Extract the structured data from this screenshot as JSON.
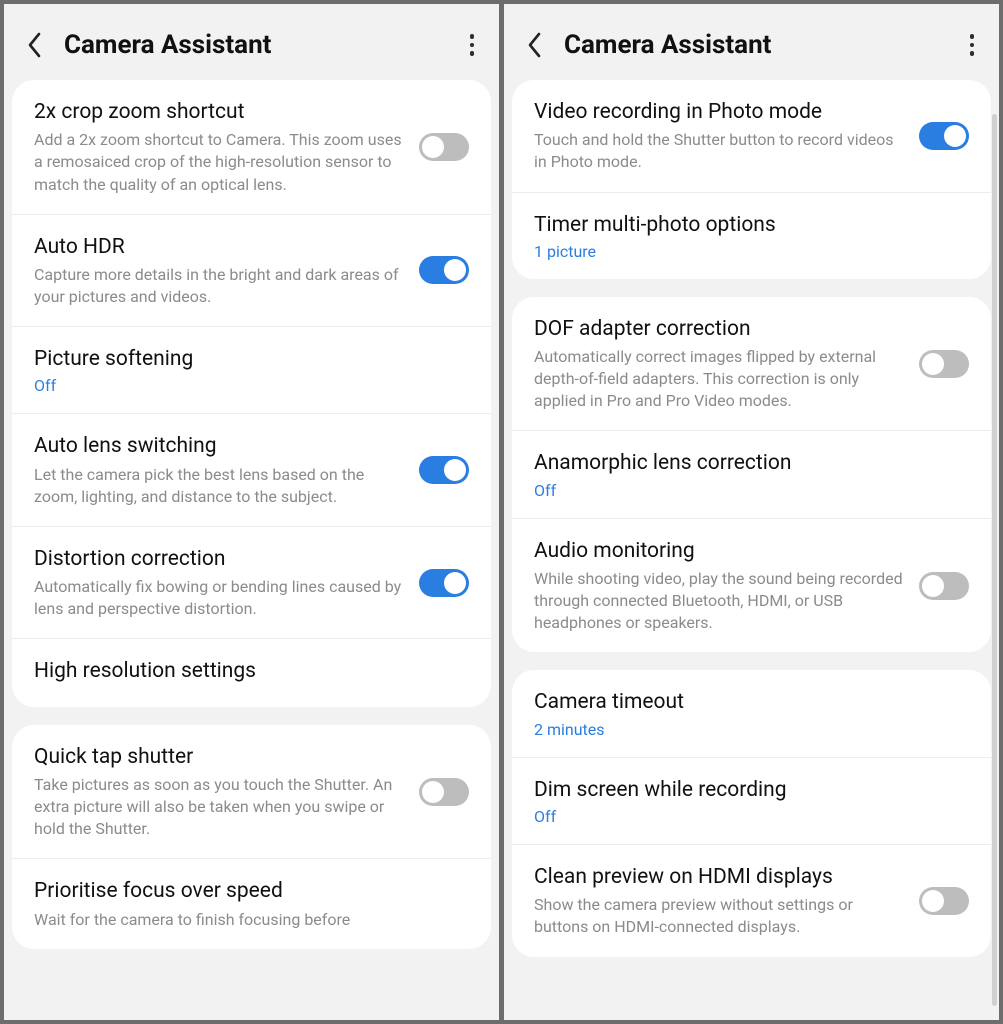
{
  "accent": "#2a7de1",
  "left": {
    "title": "Camera Assistant",
    "groups": [
      {
        "rows": [
          {
            "title": "2x crop zoom shortcut",
            "sub": "Add a 2x zoom shortcut to Camera. This zoom uses a remosaiced crop of the high-resolution sensor to match the quality of an optical lens.",
            "toggle": "off"
          },
          {
            "title": "Auto HDR",
            "sub": "Capture more details in the bright and dark areas of your pictures and videos.",
            "toggle": "on"
          },
          {
            "title": "Picture softening",
            "value": "Off"
          },
          {
            "title": "Auto lens switching",
            "sub": "Let the camera pick the best lens based on the zoom, lighting, and distance to the subject.",
            "toggle": "on"
          },
          {
            "title": "Distortion correction",
            "sub": "Automatically fix bowing or bending lines caused by lens and perspective distortion.",
            "toggle": "on"
          },
          {
            "title": "High resolution settings"
          }
        ]
      },
      {
        "rows": [
          {
            "title": "Quick tap shutter",
            "sub": "Take pictures as soon as you touch the Shutter. An extra picture will also be taken when you swipe or hold the Shutter.",
            "toggle": "off"
          },
          {
            "title": "Prioritise focus over speed",
            "sub": "Wait for the camera to finish focusing before"
          }
        ]
      }
    ]
  },
  "right": {
    "title": "Camera Assistant",
    "groups": [
      {
        "rows": [
          {
            "title": "Video recording in Photo mode",
            "sub": "Touch and hold the Shutter button to record videos in Photo mode.",
            "toggle": "on"
          },
          {
            "title": "Timer multi-photo options",
            "value": "1 picture"
          }
        ]
      },
      {
        "rows": [
          {
            "title": "DOF adapter correction",
            "sub": "Automatically correct images flipped by external depth-of-field adapters. This correction is only applied in Pro and Pro Video modes.",
            "toggle": "off"
          },
          {
            "title": "Anamorphic lens correction",
            "value": "Off"
          },
          {
            "title": "Audio monitoring",
            "sub": "While shooting video, play the sound being recorded through connected Bluetooth, HDMI, or USB headphones or speakers.",
            "toggle": "off"
          }
        ]
      },
      {
        "rows": [
          {
            "title": "Camera timeout",
            "value": "2 minutes"
          },
          {
            "title": "Dim screen while recording",
            "value": "Off"
          },
          {
            "title": "Clean preview on HDMI displays",
            "sub": "Show the camera preview without settings or buttons on HDMI-connected displays.",
            "toggle": "off"
          }
        ]
      }
    ]
  }
}
